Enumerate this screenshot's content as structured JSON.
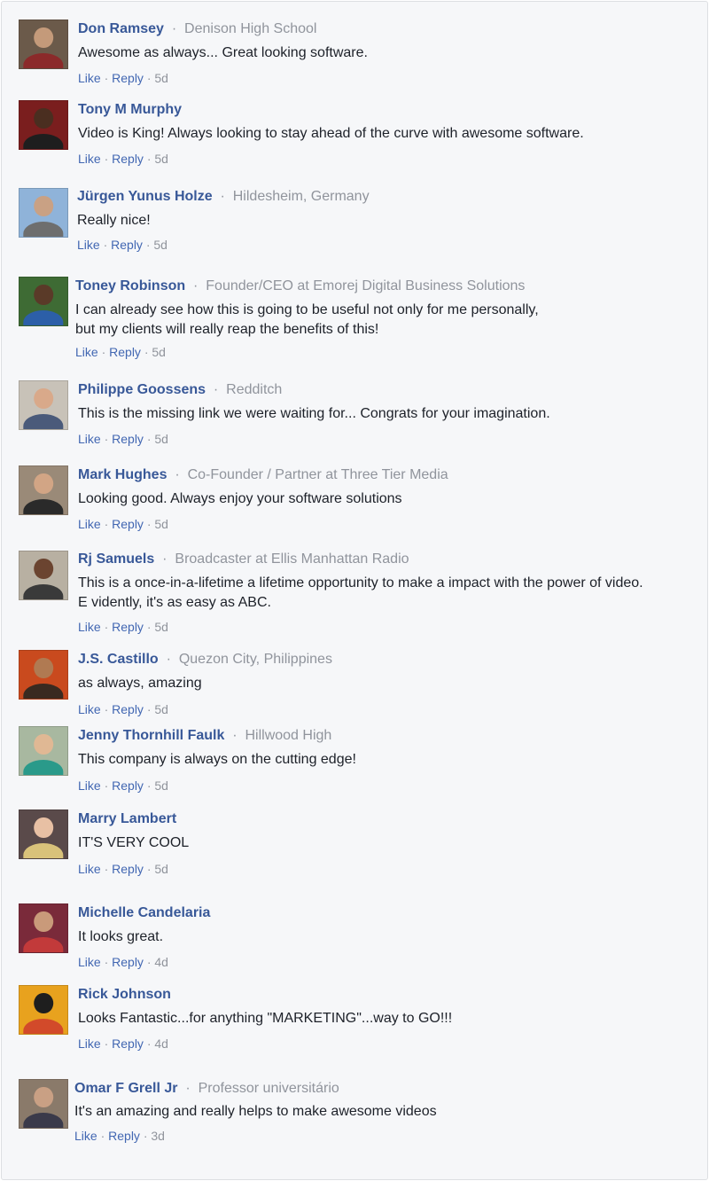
{
  "comments": [
    {
      "name": "Don Ramsey",
      "meta": "Denison High School",
      "text": "Awesome as always... Great looking software.",
      "time": "5d",
      "avatar": {
        "bg": "#6b5a4a",
        "face": "#c49a7a",
        "body": "#8b2a2a"
      }
    },
    {
      "name": "Tony M Murphy",
      "meta": "",
      "text": "Video is King! Always looking to stay ahead of the curve with awesome software.",
      "time": "5d",
      "avatar": {
        "bg": "#7a1e1e",
        "face": "#4a2e20",
        "body": "#1e1e1e"
      }
    },
    {
      "name": "Jürgen Yunus Holze",
      "meta": "Hildesheim, Germany",
      "text": "Really nice!",
      "time": "5d",
      "avatar": {
        "bg": "#8fb3d9",
        "face": "#c9a184",
        "body": "#6e6e6e"
      }
    },
    {
      "name": "Toney Robinson",
      "meta": "Founder/CEO at Emorej Digital Business Solutions",
      "text": "I can already see how this is going to be useful not only for me personally,\nbut my clients will really reap the benefits of this!",
      "time": "5d",
      "avatar": {
        "bg": "#3e6b34",
        "face": "#5a3a28",
        "body": "#2c5fa8"
      }
    },
    {
      "name": "Philippe Goossens",
      "meta": "Redditch",
      "text": "This is the missing link we were waiting for... Congrats for your imagination.",
      "time": "5d",
      "avatar": {
        "bg": "#c8c2b8",
        "face": "#d9a98a",
        "body": "#4a5a7a"
      }
    },
    {
      "name": "Mark Hughes",
      "meta": "Co-Founder / Partner at Three Tier Media",
      "text": "Looking good. Always enjoy your software solutions",
      "time": "5d",
      "avatar": {
        "bg": "#9a8a78",
        "face": "#d2a585",
        "body": "#2a2a2a"
      }
    },
    {
      "name": "Rj Samuels",
      "meta": "Broadcaster at Ellis Manhattan Radio",
      "text": "This is a once-in-a-lifetime a lifetime opportunity to make a impact with the power of video.\n E vidently, it's as easy as  ABC.",
      "time": "5d",
      "avatar": {
        "bg": "#b8b0a2",
        "face": "#6b4430",
        "body": "#3a3a3a"
      }
    },
    {
      "name": "J.S. Castillo",
      "meta": "Quezon City, Philippines",
      "text": "as always, amazing",
      "time": "5d",
      "avatar": {
        "bg": "#c94a1e",
        "face": "#b07a52",
        "body": "#3a2a20"
      }
    },
    {
      "name": "Jenny Thornhill Faulk",
      "meta": "Hillwood High",
      "text": "This company is always on the cutting edge!",
      "time": "5d",
      "avatar": {
        "bg": "#a8b8a0",
        "face": "#e0b894",
        "body": "#2a9a8a"
      }
    },
    {
      "name": "Marry Lambert",
      "meta": "",
      "text": "IT'S VERY COOL",
      "time": "5d",
      "avatar": {
        "bg": "#5a4a4a",
        "face": "#e8c0a4",
        "body": "#d9c27a"
      }
    },
    {
      "name": "Michelle Candelaria",
      "meta": "",
      "text": "It looks great.",
      "time": "4d",
      "avatar": {
        "bg": "#7a2a3a",
        "face": "#c99a7a",
        "body": "#c23a3a"
      }
    },
    {
      "name": "Rick Johnson",
      "meta": "",
      "text": "Looks Fantastic...for anything \"MARKETING\"...way to GO!!!",
      "time": "4d",
      "avatar": {
        "bg": "#e8a21e",
        "face": "#1e1e1e",
        "body": "#d24a2a"
      }
    },
    {
      "name": "Omar F Grell Jr",
      "meta": "Professor universitário",
      "text": "It's an amazing and really helps to make awesome videos",
      "time": "3d",
      "avatar": {
        "bg": "#8a7a6a",
        "face": "#c9a084",
        "body": "#3a3a4a"
      }
    }
  ],
  "labels": {
    "like": "Like",
    "reply": "Reply",
    "separator": "·"
  }
}
